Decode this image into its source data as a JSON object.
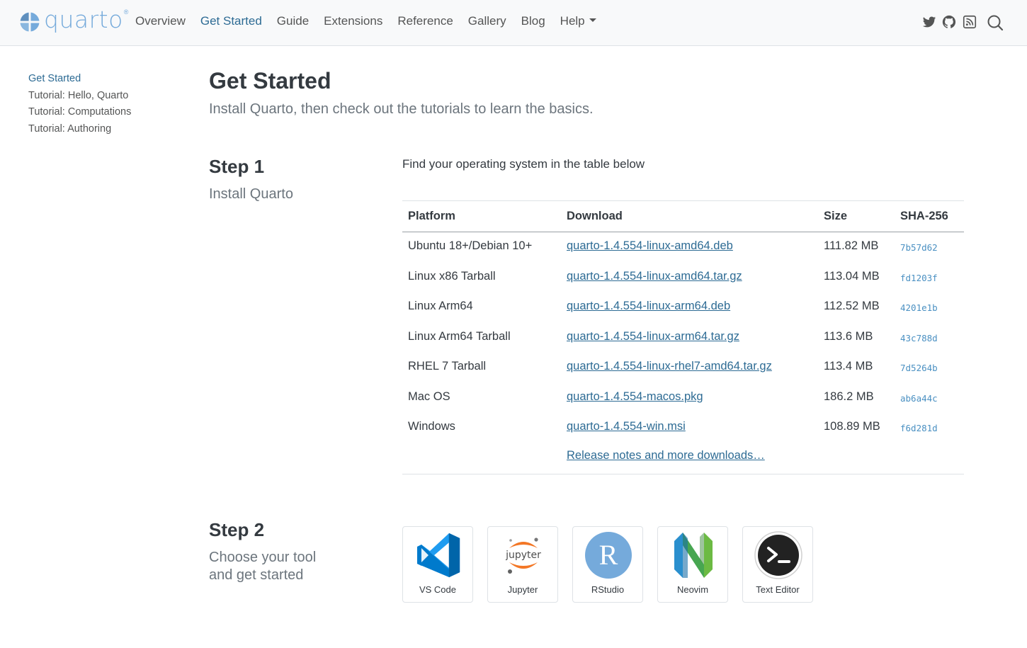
{
  "brand": {
    "name": "quarto",
    "reg": "®"
  },
  "nav": {
    "items": [
      {
        "label": "Overview"
      },
      {
        "label": "Get Started",
        "active": true
      },
      {
        "label": "Guide"
      },
      {
        "label": "Extensions"
      },
      {
        "label": "Reference"
      },
      {
        "label": "Gallery"
      },
      {
        "label": "Blog"
      },
      {
        "label": "Help",
        "dropdown": true
      }
    ],
    "tools": [
      "twitter-icon",
      "github-icon",
      "rss-icon",
      "search-icon"
    ]
  },
  "sidebar": {
    "items": [
      {
        "label": "Get Started",
        "active": true
      },
      {
        "label": "Tutorial: Hello, Quarto"
      },
      {
        "label": "Tutorial: Computations"
      },
      {
        "label": "Tutorial: Authoring"
      }
    ]
  },
  "page": {
    "title": "Get Started",
    "subtitle": "Install Quarto, then check out the tutorials to learn the basics."
  },
  "step1": {
    "title": "Step 1",
    "subtitle": "Install Quarto",
    "intro": "Find your operating system in the table below",
    "table": {
      "headers": [
        "Platform",
        "Download",
        "Size",
        "SHA-256"
      ],
      "rows": [
        {
          "platform": "Ubuntu 18+/Debian 10+",
          "download": "quarto-1.4.554-linux-amd64.deb",
          "size": "111.82 MB",
          "sha": "7b57d62"
        },
        {
          "platform": "Linux x86 Tarball",
          "download": "quarto-1.4.554-linux-amd64.tar.gz",
          "size": "113.04 MB",
          "sha": "fd1203f"
        },
        {
          "platform": "Linux Arm64",
          "download": "quarto-1.4.554-linux-arm64.deb",
          "size": "112.52 MB",
          "sha": "4201e1b"
        },
        {
          "platform": "Linux Arm64 Tarball",
          "download": "quarto-1.4.554-linux-arm64.tar.gz",
          "size": "113.6 MB",
          "sha": "43c788d"
        },
        {
          "platform": "RHEL 7 Tarball",
          "download": "quarto-1.4.554-linux-rhel7-amd64.tar.gz",
          "size": "113.4 MB",
          "sha": "7d5264b"
        },
        {
          "platform": "Mac OS",
          "download": "quarto-1.4.554-macos.pkg",
          "size": "186.2 MB",
          "sha": "ab6a44c"
        },
        {
          "platform": "Windows",
          "download": "quarto-1.4.554-win.msi",
          "size": "108.89 MB",
          "sha": "f6d281d"
        }
      ],
      "more_link": "Release notes and more downloads…"
    }
  },
  "step2": {
    "title": "Step 2",
    "subtitle_line1": "Choose your tool",
    "subtitle_line2": "and get started",
    "tools": [
      {
        "label": "VS Code",
        "icon": "vscode-icon"
      },
      {
        "label": "Jupyter",
        "icon": "jupyter-icon",
        "icon_text": "jupyter"
      },
      {
        "label": "RStudio",
        "icon": "rstudio-icon",
        "icon_text": "R"
      },
      {
        "label": "Neovim",
        "icon": "neovim-icon"
      },
      {
        "label": "Text Editor",
        "icon": "terminal-icon"
      }
    ]
  },
  "colors": {
    "accent": "#2d6b94",
    "brand": "#75aadb",
    "navbar_bg": "#f8f9fa"
  }
}
